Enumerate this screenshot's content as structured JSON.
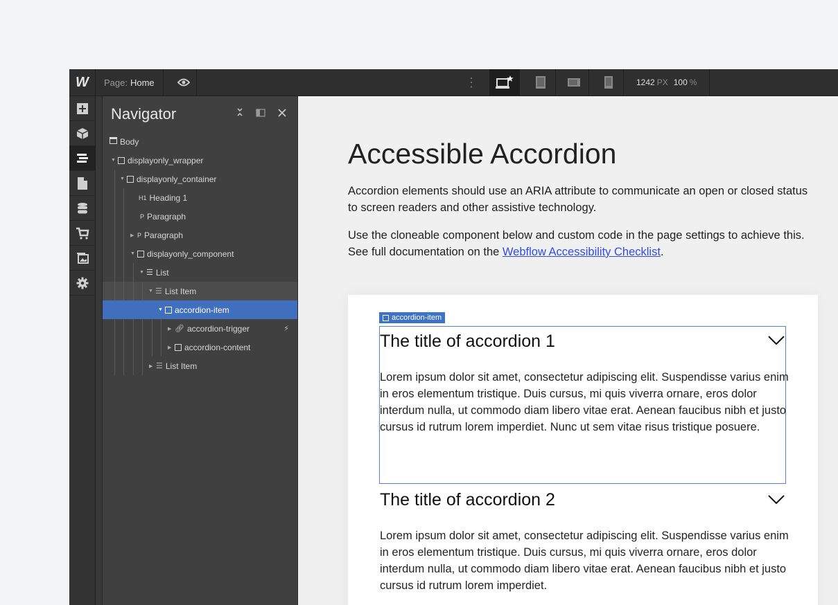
{
  "topbar": {
    "logo": "W",
    "page_prefix": "Page:",
    "page_name": "Home",
    "viewport_width": "1242",
    "viewport_width_unit": "PX",
    "zoom": "100",
    "zoom_unit": "%",
    "breakpoints": [
      "desktop-base-icon",
      "tablet-icon",
      "mobile-landscape-icon",
      "mobile-portrait-icon"
    ]
  },
  "left_toolbar": [
    "add-icon",
    "components-icon",
    "navigator-icon",
    "pages-icon",
    "cms-icon",
    "ecommerce-icon",
    "assets-icon",
    "settings-icon"
  ],
  "navigator": {
    "title": "Navigator",
    "tree": [
      {
        "label": "Body"
      },
      {
        "label": "displayonly_wrapper"
      },
      {
        "label": "displayonly_container"
      },
      {
        "label": "Heading 1",
        "tag": "H1"
      },
      {
        "label": "Paragraph",
        "tag": "P"
      },
      {
        "label": "Paragraph",
        "tag": "P"
      },
      {
        "label": "displayonly_component"
      },
      {
        "label": "List"
      },
      {
        "label": "List Item"
      },
      {
        "label": "accordion-item"
      },
      {
        "label": "accordion-trigger"
      },
      {
        "label": "accordion-content"
      },
      {
        "label": "List Item"
      }
    ]
  },
  "canvas": {
    "heading": "Accessible Accordion",
    "intro": "Accordion elements should use an ARIA attribute to communicate an open or closed status to screen readers and other assistive technology.",
    "instructions_before": "Use the cloneable component below and custom code in the page settings to achieve this. See full documentation on the ",
    "link_text": "Webflow Accessibility Checklist",
    "instructions_after": ".",
    "selected_label": "accordion-item",
    "accordions": [
      {
        "title": "The title of accordion 1",
        "body": "Lorem ipsum dolor sit amet, consectetur adipiscing elit. Suspendisse varius enim in eros elementum tristique. Duis cursus, mi quis viverra ornare, eros dolor interdum nulla, ut commodo diam libero vitae erat. Aenean faucibus nibh et justo cursus id rutrum lorem imperdiet. Nunc ut sem vitae risus tristique posuere."
      },
      {
        "title": "The title of accordion 2",
        "body": "Lorem ipsum dolor sit amet, consectetur adipiscing elit. Suspendisse varius enim in eros elementum tristique. Duis cursus, mi quis viverra ornare, eros dolor interdum nulla, ut commodo diam libero vitae erat. Aenean faucibus nibh et justo cursus id rutrum lorem imperdiet."
      }
    ]
  }
}
